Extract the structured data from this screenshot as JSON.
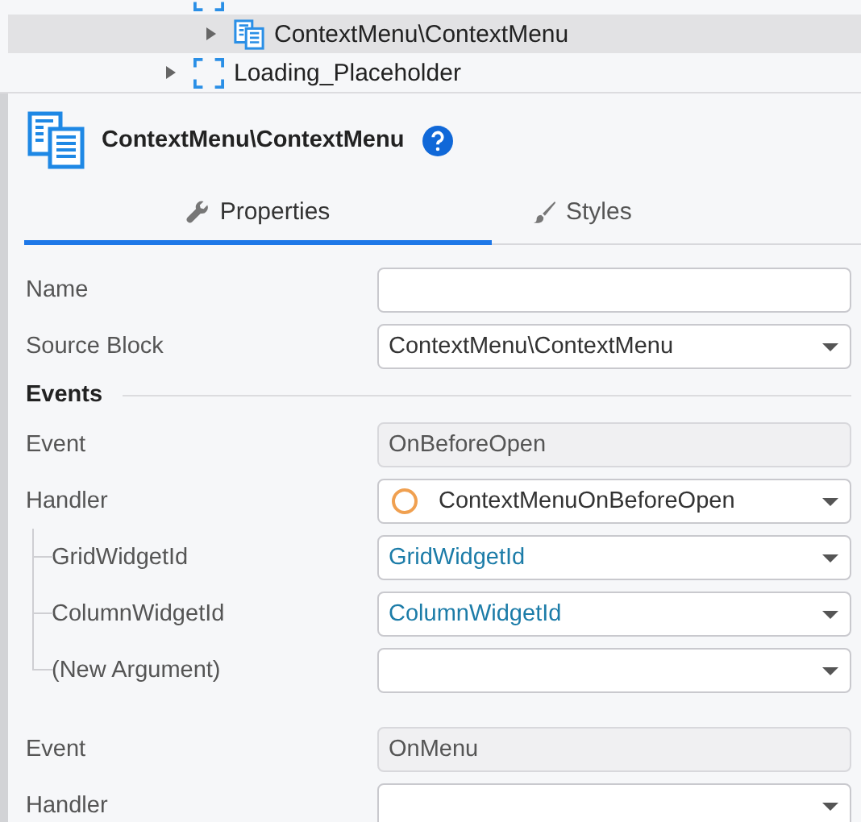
{
  "tree": [
    {
      "kind": "placeholder",
      "expanded": true,
      "selected": false,
      "children": [
        {
          "kind": "block",
          "label": "ContextMenu\\ContextMenu",
          "expanded": false,
          "selected": true
        }
      ]
    },
    {
      "kind": "placeholder",
      "label": "Loading_Placeholder",
      "expanded": false,
      "selected": false
    }
  ],
  "header": {
    "title": "ContextMenu\\ContextMenu"
  },
  "tabs": [
    {
      "label": "Properties",
      "kind": "wrench",
      "selected": true
    },
    {
      "label": "Styles",
      "kind": "brush",
      "selected": false
    }
  ],
  "properties": [
    {
      "label": "Name",
      "kind": "text"
    },
    {
      "label": "Source Block",
      "kind": "select",
      "value": "ContextMenu\\ContextMenu"
    }
  ],
  "events_section": {
    "title": "Events",
    "events": [
      {
        "label": "Event",
        "event": "OnBeforeOpen",
        "handler_label": "Handler",
        "handler_value": "ContextMenuOnBeforeOpen",
        "arguments": [
          {
            "label": "GridWidgetId",
            "value": "GridWidgetId"
          },
          {
            "label": "ColumnWidgetId",
            "value": "ColumnWidgetId"
          },
          {
            "label": "(New Argument)"
          }
        ]
      },
      {
        "label": "Event",
        "event": "OnMenu",
        "handler_label": "Handler"
      }
    ]
  }
}
